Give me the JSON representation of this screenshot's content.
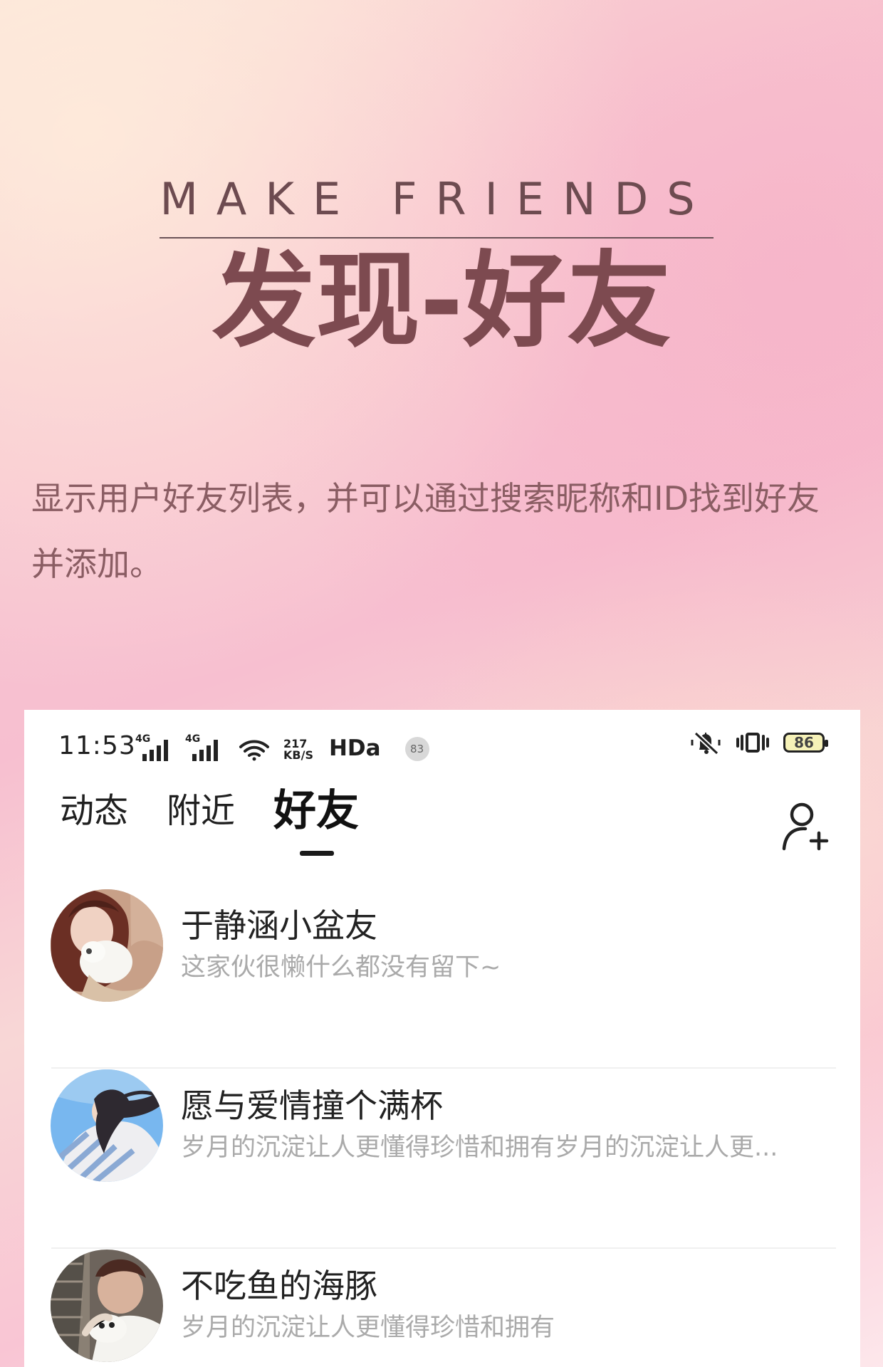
{
  "hero": {
    "subtitle": "MAKE FRIENDS",
    "title": "发现-好友",
    "description": "显示用户好友列表，并可以通过搜索昵称和ID找到好友并添加。"
  },
  "status_bar": {
    "time": "11:53",
    "network_1": "4G",
    "network_2": "4G",
    "speed_value": "217",
    "speed_unit": "KB/S",
    "hd_label": "HDa",
    "notification_count": "83",
    "battery": "86"
  },
  "tabs": [
    {
      "label": "动态",
      "active": false
    },
    {
      "label": "附近",
      "active": false
    },
    {
      "label": "好友",
      "active": true
    }
  ],
  "friends": [
    {
      "name": "于静涵小盆友",
      "bio": "这家伙很懒什么都没有留下~",
      "avatar_icon": "girl-with-puppy-avatar"
    },
    {
      "name": "愿与爱情撞个满杯",
      "bio": "岁月的沉淀让人更懂得珍惜和拥有岁月的沉淀让人更...",
      "avatar_icon": "girl-with-windswept-hair-avatar"
    },
    {
      "name": "不吃鱼的海豚",
      "bio": "岁月的沉淀让人更懂得珍惜和拥有",
      "avatar_icon": "boy-with-dog-avatar"
    }
  ],
  "colors": {
    "accent_text": "#7d4a50",
    "card_bg": "#ffffff",
    "muted_text": "#aaaaaa"
  }
}
